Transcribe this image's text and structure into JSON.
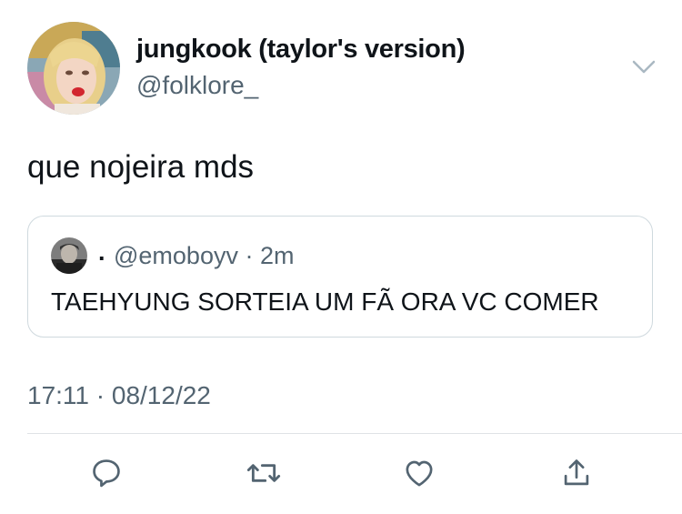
{
  "author": {
    "display_name": "jungkook (taylor's version)",
    "handle": "@folklore_"
  },
  "tweet": {
    "text": "que nojeira mds",
    "timestamp": "17:11 · 08/12/22"
  },
  "quoted_tweet": {
    "display_name": ".",
    "handle_time": "@emoboyv · 2m",
    "text": "TAEHYUNG SORTEIA UM FÃ ORA VC COMER"
  },
  "icons": {
    "menu": "chevron-down-icon",
    "reply": "reply-icon",
    "retweet": "retweet-icon",
    "like": "heart-icon",
    "share": "share-icon"
  },
  "colors": {
    "text": "#0f1419",
    "secondary": "#536471",
    "border": "#cfd9de"
  }
}
